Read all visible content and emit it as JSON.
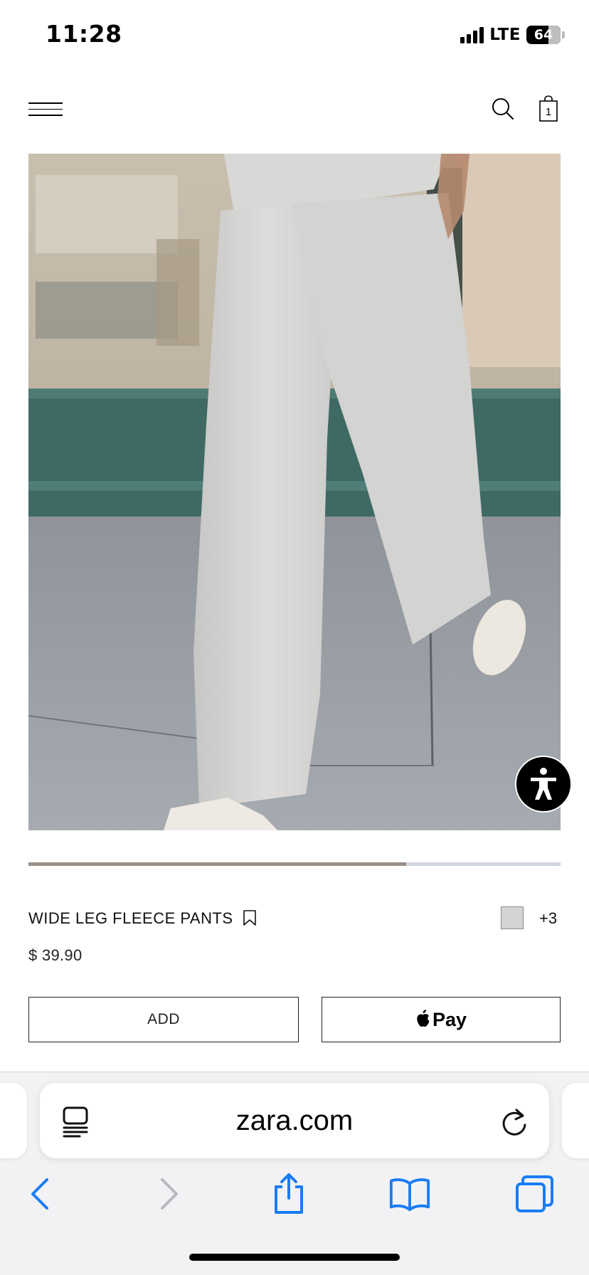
{
  "status_bar": {
    "time": "11:28",
    "network": "LTE",
    "battery_level": "64",
    "battery_fraction": 0.64
  },
  "header": {
    "menu_icon": "hamburger-icon",
    "search_icon": "search-icon",
    "cart_icon": "shopping-bag-icon",
    "cart_count": "1"
  },
  "gallery": {
    "image_description_icon": "product-photo",
    "progress_fraction": 0.71
  },
  "accessibility": {
    "icon": "accessibility-icon"
  },
  "product": {
    "name": "WIDE LEG FLEECE PANTS",
    "bookmark_icon": "bookmark-icon",
    "swatch_color": "#d4d4d4",
    "more_colors": "+3",
    "price": "$ 39.90"
  },
  "actions": {
    "add_label": "ADD",
    "pay_label": "Pay",
    "pay_icon": "apple-icon"
  },
  "browser": {
    "url": "zara.com",
    "reader_icon": "reader-icon",
    "reload_icon": "reload-icon",
    "toolbar": {
      "back_icon": "chevron-left-icon",
      "forward_icon": "chevron-right-icon",
      "share_icon": "share-icon",
      "bookmarks_icon": "book-icon",
      "tabs_icon": "tabs-icon",
      "accent_color": "#1a7cf5",
      "disabled_color": "#b8b8bd"
    }
  }
}
